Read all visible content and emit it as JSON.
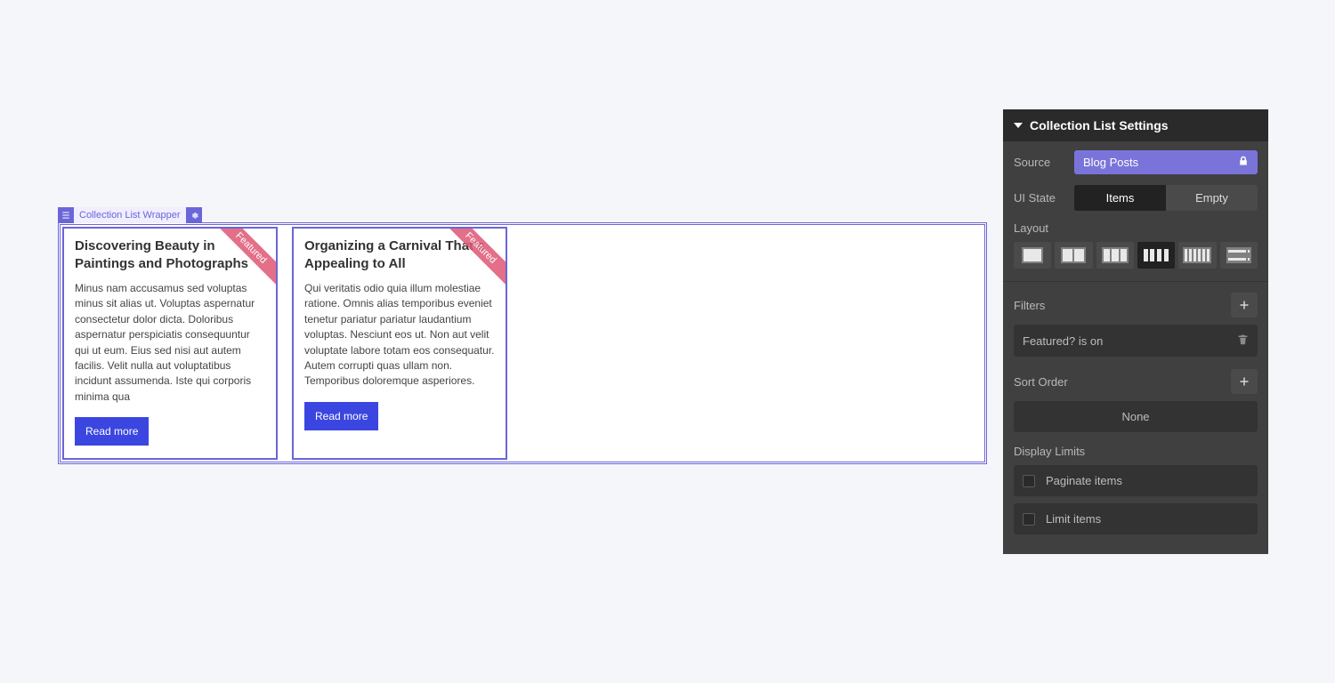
{
  "canvas": {
    "selection_label": "Collection List Wrapper",
    "cards": [
      {
        "title": "Discovering Beauty in Paintings and Photographs",
        "body": "Minus nam accusamus sed voluptas minus sit alias ut. Voluptas aspernatur consectetur dolor dicta. Doloribus aspernatur perspiciatis consequuntur qui ut eum. Eius sed nisi aut autem facilis. Velit nulla aut voluptatibus incidunt assumenda. Iste qui corporis minima qua",
        "ribbon": "Featured",
        "button": "Read more"
      },
      {
        "title": "Organizing a Carnival That's Appealing to All",
        "body": "Qui veritatis odio quia illum molestiae ratione. Omnis alias temporibus eveniet tenetur pariatur pariatur laudantium voluptas. Nesciunt eos ut. Non aut velit voluptate labore totam eos consequatur. Autem corrupti quas ullam non. Temporibus doloremque asperiores.",
        "ribbon": "Featured",
        "button": "Read more"
      }
    ]
  },
  "panel": {
    "title": "Collection List Settings",
    "source_label": "Source",
    "source_value": "Blog Posts",
    "uistate_label": "UI State",
    "uistate_items": "Items",
    "uistate_empty": "Empty",
    "layout_label": "Layout",
    "filters_label": "Filters",
    "filter_item": "Featured? is on",
    "sort_label": "Sort Order",
    "sort_none": "None",
    "display_limits_label": "Display Limits",
    "paginate_label": "Paginate items",
    "limit_label": "Limit items"
  }
}
